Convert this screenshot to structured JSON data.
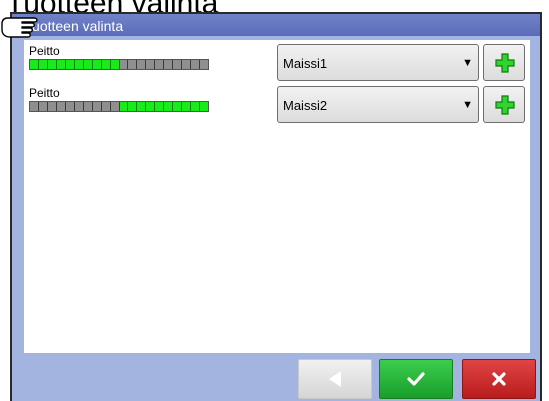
{
  "heading": "Tuotteen valinta",
  "dialog": {
    "title": "Tuotteen valinta"
  },
  "rows": [
    {
      "label": "Peitto",
      "coverage": {
        "on_range": [
          0,
          10
        ],
        "segments": 20
      },
      "product": "Maissi1"
    },
    {
      "label": "Peitto",
      "coverage": {
        "on_range": [
          10,
          20
        ],
        "segments": 20
      },
      "product": "Maissi2"
    }
  ],
  "icons": {
    "dropdown": "chevron-down-icon",
    "add": "plus-icon",
    "back": "arrow-left-icon",
    "ok": "checkmark-icon",
    "cancel": "close-icon",
    "cursor": "pointing-hand-icon"
  },
  "colors": {
    "titlebar": "#5a6cb9",
    "frame": "#a4b4e0",
    "coverage_on": "#19ea19",
    "coverage_off": "#8f8f8f",
    "ok": "#24b236",
    "cancel": "#cc2222",
    "add_icon": "#2fd42f"
  }
}
